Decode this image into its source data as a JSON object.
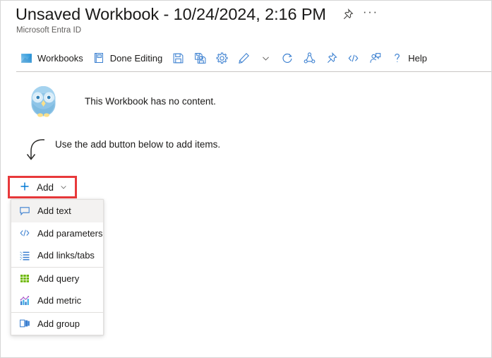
{
  "header": {
    "title": "Unsaved Workbook - 10/24/2024, 2:16 PM",
    "subtitle": "Microsoft Entra ID",
    "pin_icon": "pin-icon",
    "more_label": "···"
  },
  "toolbar": {
    "items": [
      {
        "label": "Workbooks",
        "icon": "workbooks-chart-icon",
        "has_label": true
      },
      {
        "label": "Done Editing",
        "icon": "done-editing-book-icon",
        "has_label": true
      },
      {
        "label": "",
        "icon": "save-floppy-icon",
        "has_label": false
      },
      {
        "label": "",
        "icon": "save-as-copy-icon",
        "has_label": false
      },
      {
        "label": "",
        "icon": "gear-settings-icon",
        "has_label": false
      },
      {
        "label": "",
        "icon": "edit-pencil-icon",
        "has_label": false
      },
      {
        "label": "",
        "icon": "chevron-down-icon",
        "has_label": false
      },
      {
        "label": "",
        "icon": "refresh-icon",
        "has_label": false
      },
      {
        "label": "",
        "icon": "share-icon",
        "has_label": false
      },
      {
        "label": "",
        "icon": "pin-icon",
        "has_label": false
      },
      {
        "label": "",
        "icon": "code-brackets-icon",
        "has_label": false
      },
      {
        "label": "",
        "icon": "feedback-person-icon",
        "has_label": false
      },
      {
        "label": "Help",
        "icon": "question-mark-icon",
        "has_label": true
      }
    ]
  },
  "content": {
    "empty_message": "This Workbook has no content.",
    "hint_message": "Use the add button below to add items.",
    "owl_icon": "owl-illustration-icon",
    "arrow_icon": "curved-down-arrow-icon"
  },
  "add_button": {
    "label": "Add",
    "plus_icon": "plus-icon",
    "chevron_icon": "chevron-down-icon",
    "highlight_color": "#e8393b"
  },
  "menu": {
    "groups": [
      [
        {
          "label": "Add text",
          "icon": "text-comment-icon",
          "selected": true
        },
        {
          "label": "Add parameters",
          "icon": "code-brackets-icon",
          "selected": false
        },
        {
          "label": "Add links/tabs",
          "icon": "list-links-icon",
          "selected": false
        }
      ],
      [
        {
          "label": "Add query",
          "icon": "grid-query-icon",
          "selected": false
        },
        {
          "label": "Add metric",
          "icon": "metric-chart-icon",
          "selected": false
        }
      ],
      [
        {
          "label": "Add group",
          "icon": "group-panels-icon",
          "selected": false
        }
      ]
    ]
  },
  "colors": {
    "accent": "#0078d4",
    "text": "#1b1a19",
    "subtext": "#605e5c",
    "border": "#e1dfdd",
    "highlight_row": "#f3f2f1",
    "query_green": "#57a300",
    "red_outline": "#e8393b"
  }
}
